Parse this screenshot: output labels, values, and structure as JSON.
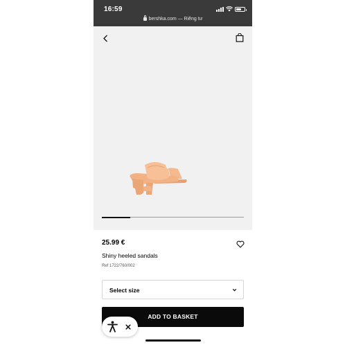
{
  "status_bar": {
    "time": "16:59",
    "url": "bershka.com — Riêng tư"
  },
  "header": {
    "back_icon": "chevron-left-icon",
    "bag_icon": "shopping-bag-icon"
  },
  "gallery": {
    "image_description_icon": "sandal-product-image",
    "position": 1,
    "count": 5
  },
  "product": {
    "price": "25.99 €",
    "name": "Shiny heeled sandals",
    "ref": "Ref 1722/760/002",
    "favorite_icon": "heart-icon"
  },
  "size_selector": {
    "label": "Select size",
    "chevron_icon": "chevron-down-icon"
  },
  "actions": {
    "add_to_basket": "ADD TO BASKET"
  },
  "accessibility": {
    "icon": "accessibility-icon",
    "close_icon": "close-icon"
  },
  "colors": {
    "status_bar": "#3a3a3a",
    "image_bg": "#f1f1f1",
    "button_bg": "#0a0a0a",
    "sandal": "#f4b487"
  }
}
